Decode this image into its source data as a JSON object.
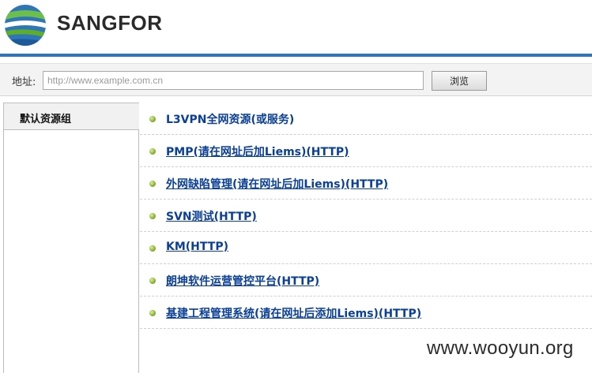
{
  "brand": {
    "name": "SANGFOR",
    "logo_icon": "sangfor-globe-logo",
    "colors": {
      "blue": "#2e76b8",
      "green": "#5fae2a"
    }
  },
  "address_bar": {
    "label": "地址:",
    "placeholder": "http://www.example.com.cn",
    "value": "",
    "browse_label": "浏览"
  },
  "sidebar": {
    "tabs": [
      {
        "label": "默认资源组",
        "selected": true
      }
    ]
  },
  "resources": [
    {
      "label": "L3VPN全网资源(或服务)",
      "underlined": false
    },
    {
      "label": "PMP(请在网址后加Liems)(HTTP)",
      "underlined": true
    },
    {
      "label": "外网缺陷管理(请在网址后加Liems)(HTTP)",
      "underlined": true
    },
    {
      "label": "SVN测试(HTTP)",
      "underlined": true
    },
    {
      "label": "KM(HTTP)",
      "underlined": true
    },
    {
      "label": "朗坤软件运营管控平台(HTTP)",
      "underlined": true
    },
    {
      "label": "基建工程管理系统(请在网址后添加Liems)(HTTP)",
      "underlined": true
    }
  ],
  "watermark": "www.wooyun.org",
  "link_color": "#0a3f96"
}
